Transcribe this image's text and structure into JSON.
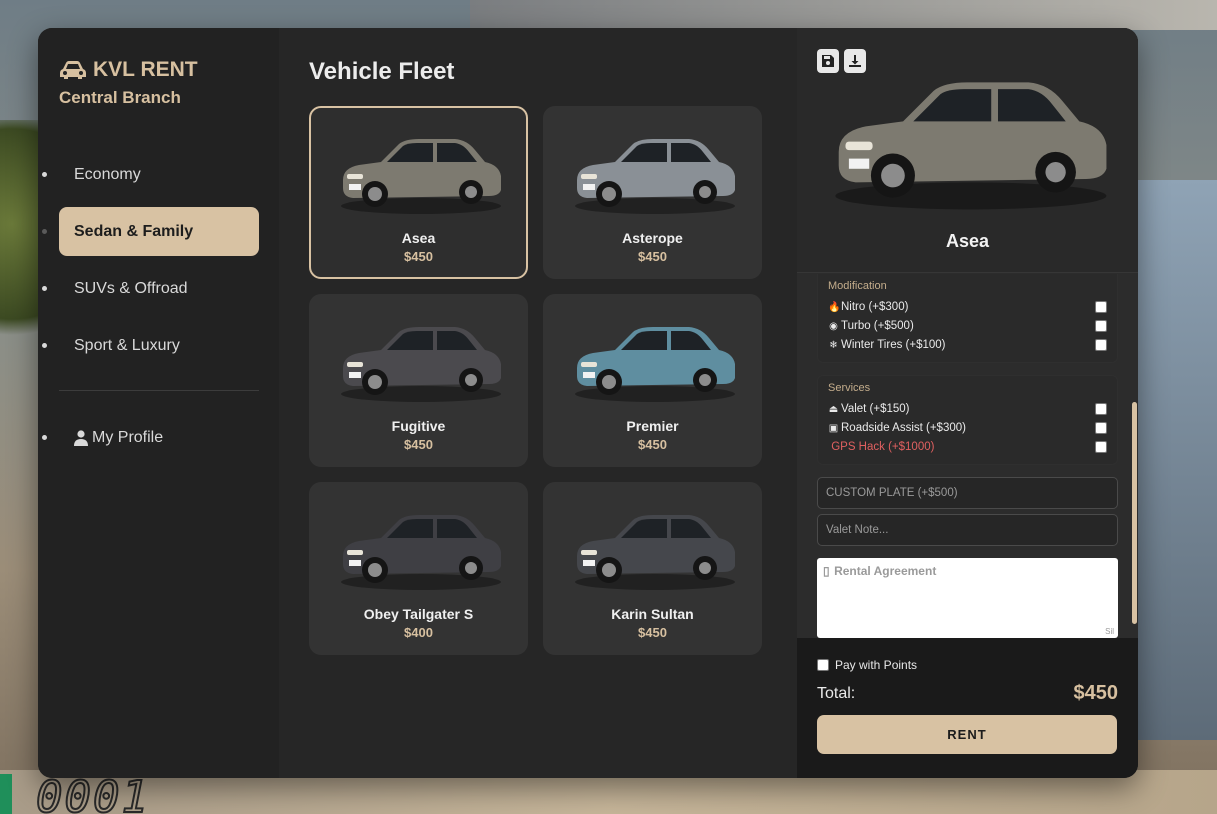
{
  "brand": {
    "name": "KVL RENT",
    "branch": "Central Branch"
  },
  "nav": {
    "items": [
      {
        "label": "Economy"
      },
      {
        "label": "Sedan & Family"
      },
      {
        "label": "SUVs & Offroad"
      },
      {
        "label": "Sport & Luxury"
      }
    ],
    "profile_label": "My Profile"
  },
  "main": {
    "title": "Vehicle Fleet"
  },
  "vehicles": [
    {
      "name": "Asea",
      "price": "$450",
      "color": "#7d7a70"
    },
    {
      "name": "Asterope",
      "price": "$450",
      "color": "#8a9096"
    },
    {
      "name": "Fugitive",
      "price": "$450",
      "color": "#4b4a4e"
    },
    {
      "name": "Premier",
      "price": "$450",
      "color": "#5f8ea0"
    },
    {
      "name": "Obey Tailgater S",
      "price": "$400",
      "color": "#3f3f44"
    },
    {
      "name": "Karin Sultan",
      "price": "$450",
      "color": "#45474c"
    }
  ],
  "detail": {
    "name": "Asea",
    "modification": {
      "title": "Modification",
      "options": [
        {
          "label": "Nitro (+$300)"
        },
        {
          "label": "Turbo (+$500)"
        },
        {
          "label": "Winter Tires (+$100)"
        }
      ]
    },
    "services": {
      "title": "Services",
      "options": [
        {
          "label": "Valet (+$150)"
        },
        {
          "label": "Roadside Assist (+$300)"
        },
        {
          "label": "GPS Hack (+$1000)"
        }
      ]
    },
    "plate_placeholder": "CUSTOM PLATE (+$500)",
    "note_placeholder": "Valet Note...",
    "agreement_placeholder": "Rental Agreement",
    "signature_hint": "Sil"
  },
  "footer": {
    "points_label": "Pay with Points",
    "total_label": "Total:",
    "total_value": "$450",
    "rent_label": "RENT"
  },
  "colors": {
    "accent": "#d8c2a3",
    "panel": "#262626",
    "danger": "#e06060"
  }
}
